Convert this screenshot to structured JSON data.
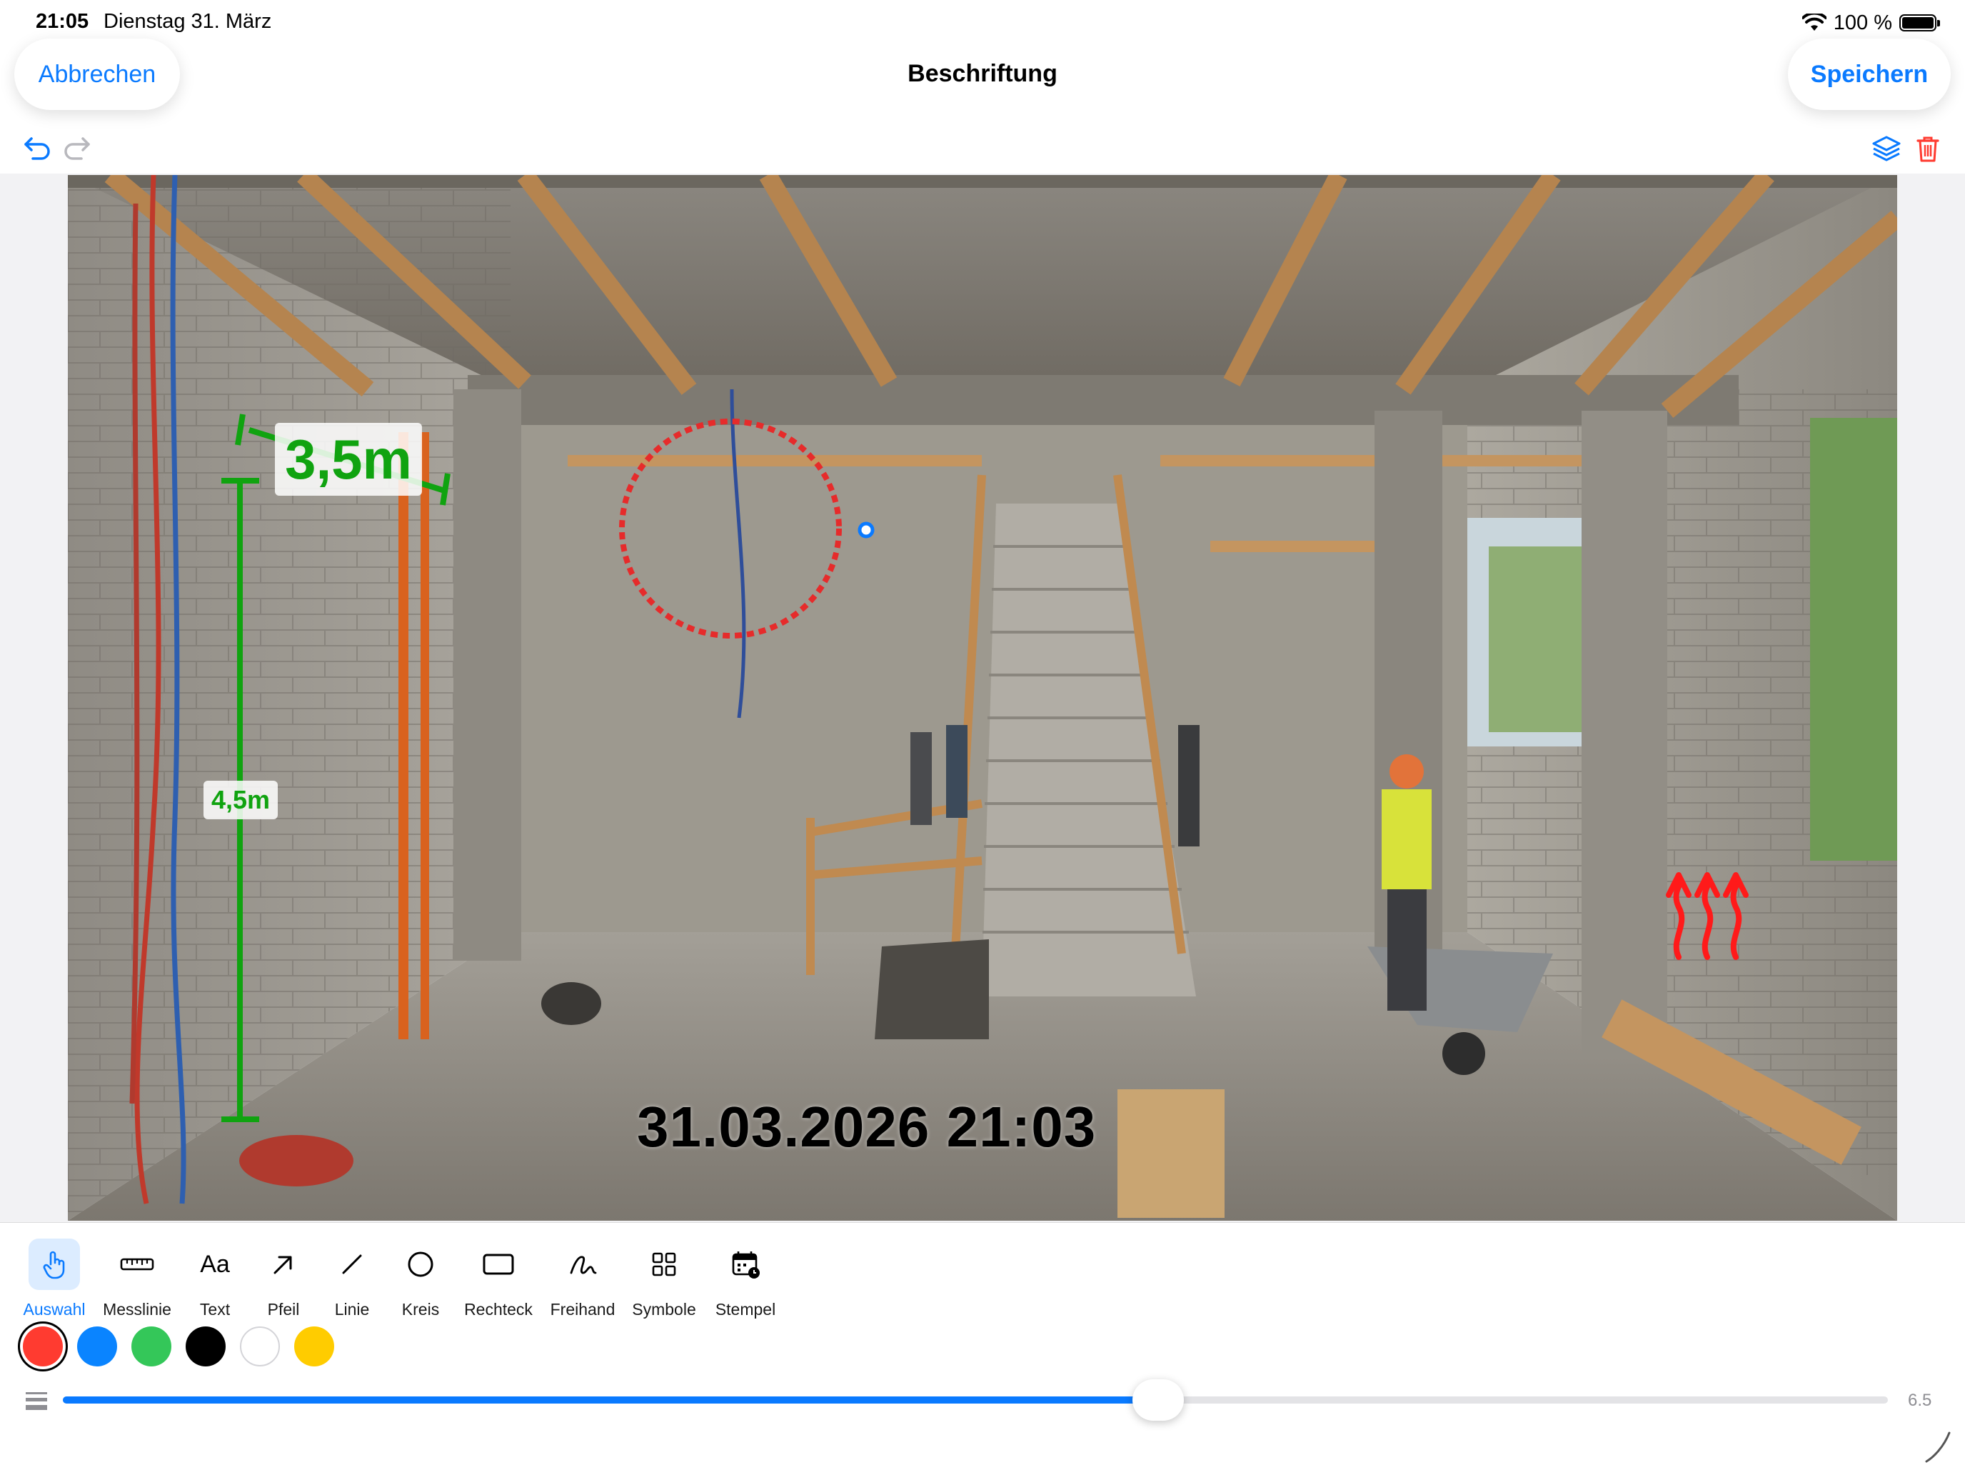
{
  "status_bar": {
    "time": "21:05",
    "date": "Dienstag 31. März",
    "battery": "100 %"
  },
  "nav": {
    "cancel_label": "Abbrechen",
    "title": "Beschriftung",
    "save_label": "Speichern"
  },
  "annotations": {
    "measure_top": "3,5m",
    "measure_left": "4,5m",
    "timestamp": "31.03.2026 21:03"
  },
  "tools": [
    {
      "label": "Auswahl",
      "icon": "hand-pointer-icon",
      "active": true
    },
    {
      "label": "Messlinie",
      "icon": "ruler-icon",
      "active": false
    },
    {
      "label": "Text",
      "icon": "text-aa-icon",
      "active": false
    },
    {
      "label": "Pfeil",
      "icon": "arrow-icon",
      "active": false
    },
    {
      "label": "Linie",
      "icon": "line-icon",
      "active": false
    },
    {
      "label": "Kreis",
      "icon": "circle-icon",
      "active": false
    },
    {
      "label": "Rechteck",
      "icon": "rectangle-icon",
      "active": false
    },
    {
      "label": "Freihand",
      "icon": "freehand-icon",
      "active": false
    },
    {
      "label": "Symbole",
      "icon": "symbols-grid-icon",
      "active": false
    },
    {
      "label": "Stempel",
      "icon": "stamp-calendar-icon",
      "active": false
    }
  ],
  "colors": [
    {
      "name": "red",
      "hex": "#ff3b30",
      "selected": true
    },
    {
      "name": "blue",
      "hex": "#0a84ff",
      "selected": false
    },
    {
      "name": "green",
      "hex": "#34c759",
      "selected": false
    },
    {
      "name": "black",
      "hex": "#000000",
      "selected": false
    },
    {
      "name": "white",
      "hex": "#ffffff",
      "selected": false
    },
    {
      "name": "yellow",
      "hex": "#ffcc00",
      "selected": false
    }
  ],
  "stroke": {
    "value": "6.5",
    "fraction": 0.6
  },
  "accent": "#0a7aff"
}
